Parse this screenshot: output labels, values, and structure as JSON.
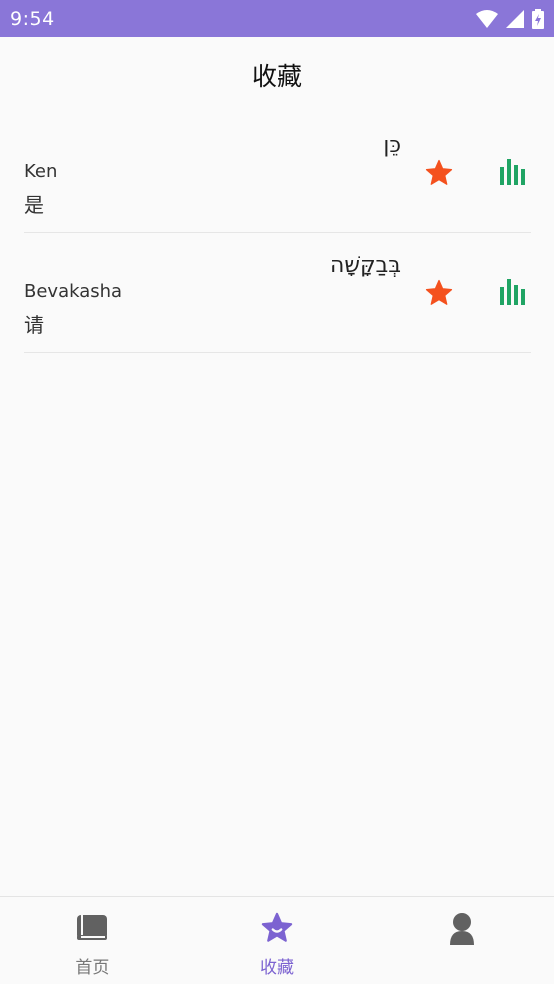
{
  "status_bar": {
    "time": "9:54",
    "icons": [
      "wifi-icon",
      "signal-icon",
      "battery-icon"
    ],
    "color": "#8a76d8"
  },
  "header": {
    "title": "收藏"
  },
  "favorites": [
    {
      "hebrew": "כֵּן",
      "romanized": "Ken",
      "meaning": "是",
      "starred": true
    },
    {
      "hebrew": "בְּבַקָּשָׁה",
      "romanized": "Bevakasha",
      "meaning": "请",
      "starred": true
    }
  ],
  "icons": {
    "star": "star-icon",
    "audio": "audio-bars-icon"
  },
  "colors": {
    "accent": "#7c63d1",
    "star": "#f4511e",
    "audio": "#20a464"
  },
  "bottom_nav": {
    "items": [
      {
        "label": "首页",
        "icon": "book-icon",
        "active": false
      },
      {
        "label": "收藏",
        "icon": "star-icon",
        "active": true
      },
      {
        "label": "",
        "icon": "user-icon",
        "active": false
      }
    ]
  }
}
